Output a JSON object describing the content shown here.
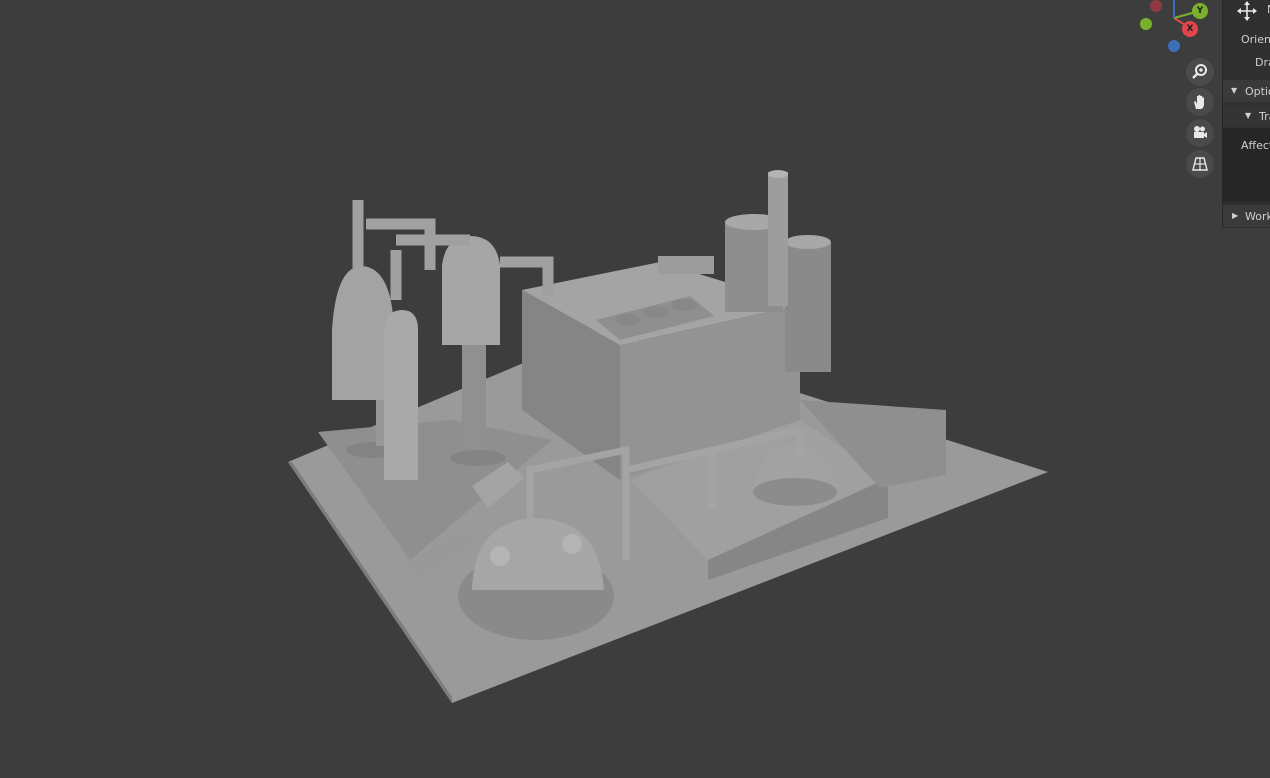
{
  "colors": {
    "viewport_bg": "#3d3d3d",
    "model_face": "#9a9a9a",
    "model_shadow": "#7d7d7d",
    "model_light": "#b0b0b0",
    "axis_x": "#e0474c",
    "axis_y": "#7ab02c",
    "axis_z": "#3d6fb6",
    "sidebar_bg": "#303030"
  },
  "gizmo": {
    "x_label": "X",
    "y_label": "Y"
  },
  "nav_buttons": [
    {
      "name": "zoom",
      "icon": "zoom-icon"
    },
    {
      "name": "pan",
      "icon": "hand-icon"
    },
    {
      "name": "camera",
      "icon": "camera-icon"
    },
    {
      "name": "perspective",
      "icon": "grid-icon"
    }
  ],
  "sidebar": {
    "tool_label": "N",
    "orientation_label": "Orient",
    "drag_label": "Dra",
    "options_header": "Optio",
    "transform_subheader": "Tra",
    "affect_label": "Affect",
    "workspace_header": "Work"
  }
}
